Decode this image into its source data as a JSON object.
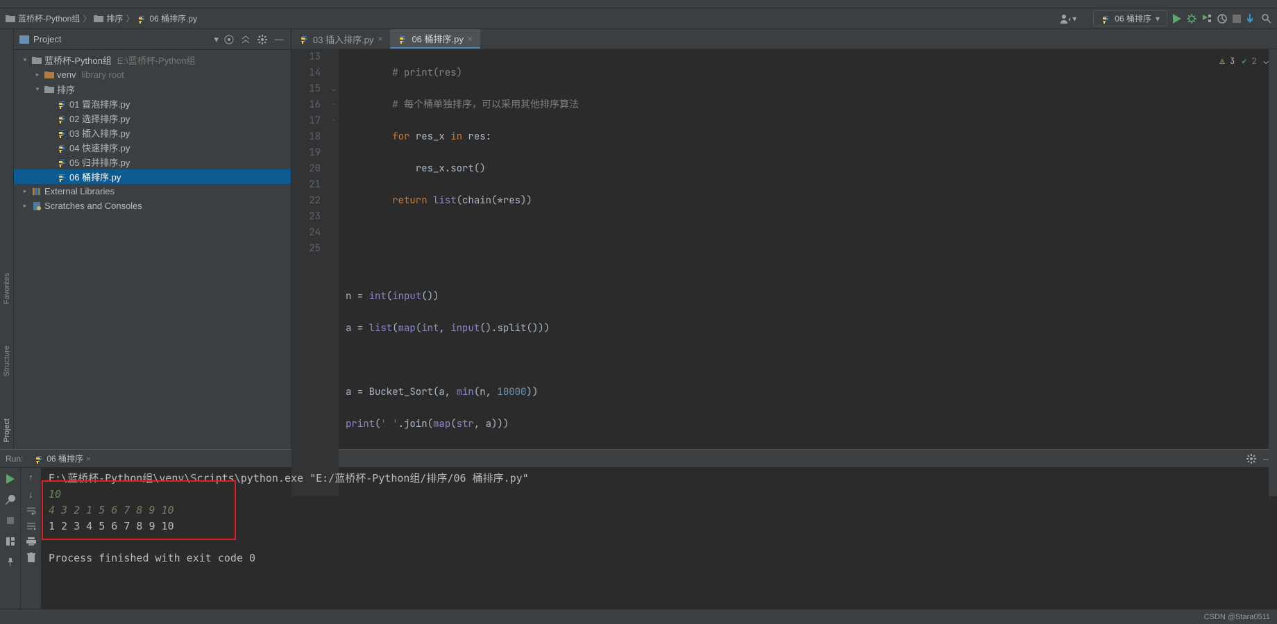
{
  "breadcrumb": {
    "root": "蓝桥杯-Python组",
    "folder": "排序",
    "file": "06 桶排序.py"
  },
  "toolbar": {
    "run_config": "06 桶排序"
  },
  "project": {
    "title": "Project",
    "root": {
      "name": "蓝桥杯-Python组",
      "hint": "E:\\蓝桥杯-Python组"
    },
    "venv": {
      "name": "venv",
      "hint": "library root"
    },
    "sort_folder": "排序",
    "files": [
      "01 冒泡排序.py",
      "02 选择排序.py",
      "03 插入排序.py",
      "04 快速排序.py",
      "05 归并排序.py",
      "06 桶排序.py"
    ],
    "ext_lib": "External Libraries",
    "scratches": "Scratches and Consoles"
  },
  "tabs": {
    "t1": "03 插入排序.py",
    "t2": "06 桶排序.py"
  },
  "editor": {
    "lines": {
      "13": {
        "comment": "# print(res)"
      },
      "14": {
        "comment": "# 每个桶单独排序，可以采用其他排序算法"
      },
      "15": {
        "kw1": "for ",
        "name": "res_x ",
        "kw2": "in ",
        "rest": "res:"
      },
      "16": {
        "rest": "res_x.sort()"
      },
      "17": {
        "kw": "return ",
        "fn": "list",
        "rest": "(chain(*res))"
      },
      "20": {
        "name": "n = ",
        "fn": "int",
        "p": "(",
        "fn2": "input",
        "rest": "())"
      },
      "21": {
        "name": "a = ",
        "fn": "list",
        "p": "(",
        "fn2": "map",
        "p2": "(",
        "fn3": "int",
        "c": ", ",
        "fn4": "input",
        "rest": "().split()))"
      },
      "23": {
        "name": "a = Bucket_Sort(a, ",
        "fn": "min",
        "p": "(n, ",
        "num": "10000",
        "rest": "))"
      },
      "24": {
        "fn": "print",
        "p": "(",
        "str": "' '",
        "m": ".join(",
        "fn2": "map",
        "p2": "(",
        "fn3": "str",
        "rest": ", a)))"
      }
    },
    "warn_count": "3",
    "ok_count": "2"
  },
  "run": {
    "label": "Run:",
    "tab": "06 桶排序",
    "cmd": "E:\\蓝桥杯-Python组\\venv\\Scripts\\python.exe \"E:/蓝桥杯-Python组/排序/06 桶排序.py\"",
    "in1": "10",
    "in2": "4 3 2 1 5 6 7 8 9 10",
    "out": "1 2 3 4 5 6 7 8 9 10",
    "exit": "Process finished with exit code 0"
  },
  "status": {
    "watermark": "CSDN @Stara0511"
  },
  "left_gutter": {
    "l1": "Project",
    "l2": "Structure",
    "l3": "Favorites"
  }
}
